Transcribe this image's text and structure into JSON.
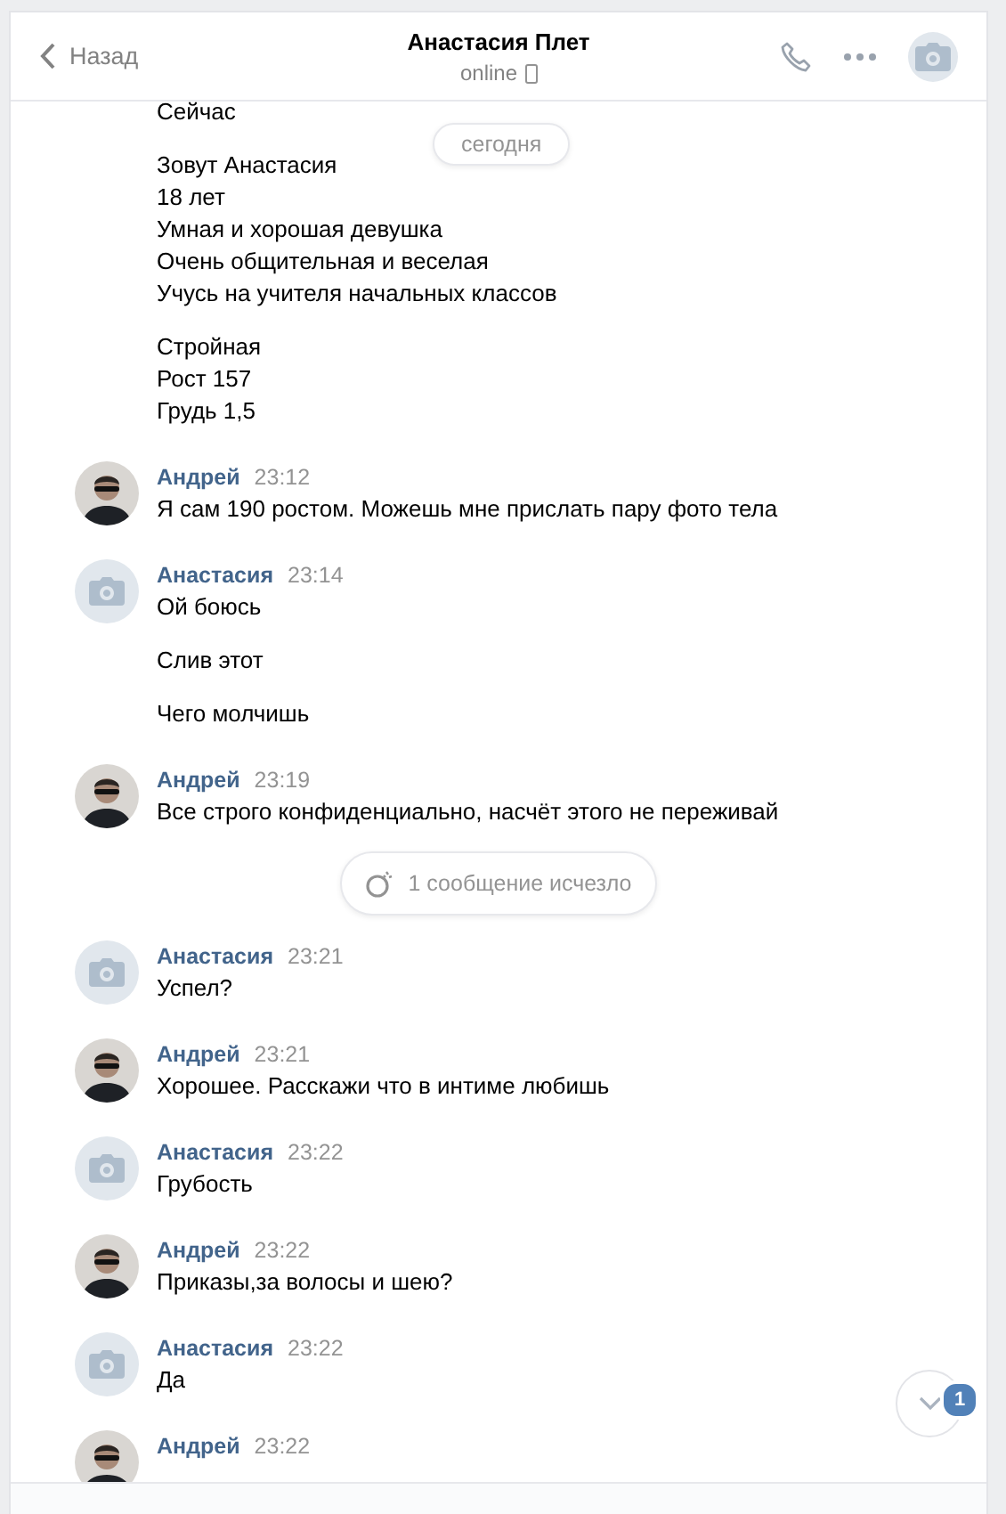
{
  "header": {
    "back_label": "Назад",
    "title": "Анастасия Плет",
    "status": "online"
  },
  "date_pill": "сегодня",
  "items": [
    {
      "kind": "continuation",
      "paragraphs": [
        [
          "Сейчас"
        ],
        [
          "Зовут Анастасия",
          "18 лет",
          "Умная и хорошая девушка",
          "Очень общительная и веселая",
          "Учусь на учителя начальных классов"
        ],
        [
          "Стройная",
          "Рост 157",
          "Грудь 1,5"
        ]
      ]
    },
    {
      "kind": "message",
      "author": "Андрей",
      "time": "23:12",
      "has_photo": true,
      "paragraphs": [
        [
          "Я сам 190 ростом. Можешь мне прислать пару фото тела"
        ]
      ]
    },
    {
      "kind": "message",
      "author": "Анастасия",
      "time": "23:14",
      "has_photo": false,
      "paragraphs": [
        [
          "Ой боюсь"
        ],
        [
          "Слив этот"
        ],
        [
          "Чего молчишь"
        ]
      ]
    },
    {
      "kind": "message",
      "author": "Андрей",
      "time": "23:19",
      "has_photo": true,
      "paragraphs": [
        [
          "Все строго конфиденциально, насчёт этого не переживай"
        ]
      ]
    },
    {
      "kind": "service",
      "text": "1 сообщение исчезло"
    },
    {
      "kind": "message",
      "author": "Анастасия",
      "time": "23:21",
      "has_photo": false,
      "paragraphs": [
        [
          "Успел?"
        ]
      ]
    },
    {
      "kind": "message",
      "author": "Андрей",
      "time": "23:21",
      "has_photo": true,
      "paragraphs": [
        [
          "Хорошее. Расскажи что в интиме любишь"
        ]
      ]
    },
    {
      "kind": "message",
      "author": "Анастасия",
      "time": "23:22",
      "has_photo": false,
      "paragraphs": [
        [
          "Грубость"
        ]
      ]
    },
    {
      "kind": "message",
      "author": "Андрей",
      "time": "23:22",
      "has_photo": true,
      "paragraphs": [
        [
          "Приказы,за волосы и шею?"
        ]
      ]
    },
    {
      "kind": "message",
      "author": "Анастасия",
      "time": "23:22",
      "has_photo": false,
      "paragraphs": [
        [
          "Да"
        ]
      ]
    },
    {
      "kind": "message",
      "author": "Андрей",
      "time": "23:22",
      "has_photo": true
    }
  ],
  "scroll_down": {
    "badge": "1"
  }
}
